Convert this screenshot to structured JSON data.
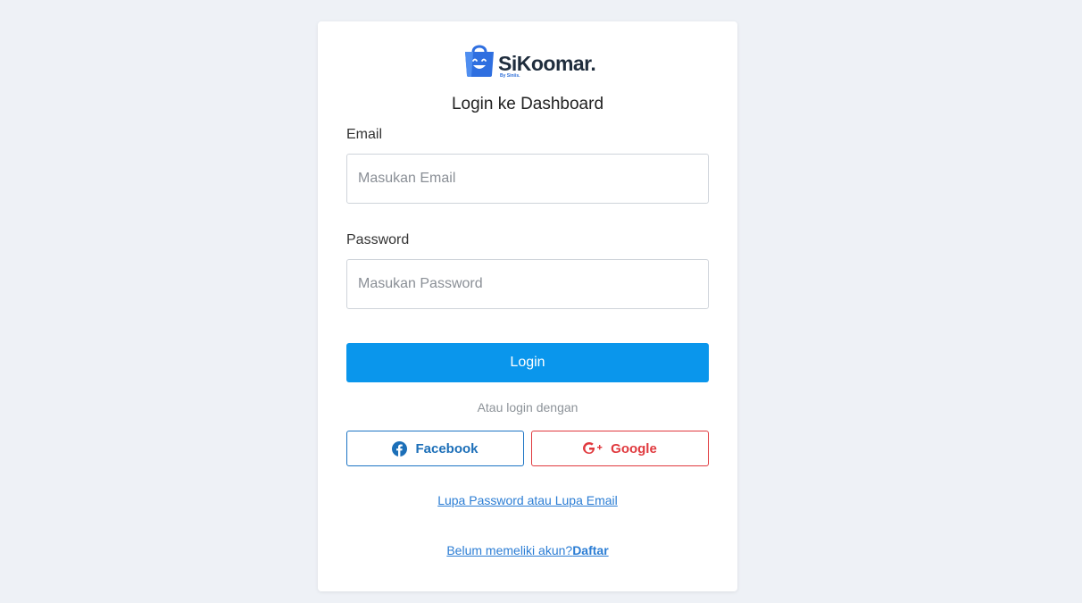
{
  "brand": {
    "name": "SiKoomar.",
    "subtitle": "By Siniis.",
    "logo_icon": "shopping-bag-smiley-icon",
    "logo_color": "#2f6fe0"
  },
  "page": {
    "title": "Login ke Dashboard"
  },
  "form": {
    "email_label": "Email",
    "email_placeholder": "Masukan Email",
    "email_value": "",
    "password_label": "Password",
    "password_placeholder": "Masukan Password",
    "password_value": "",
    "login_label": "Login"
  },
  "social": {
    "divider_text": "Atau login dengan",
    "facebook_label": "Facebook",
    "facebook_icon": "facebook-icon",
    "google_label": "Google",
    "google_icon": "google-plus-icon"
  },
  "links": {
    "forgot": "Lupa Password atau Lupa Email",
    "no_account": "Belum memeliki akun?",
    "register": "Daftar"
  },
  "colors": {
    "background": "#eef1f6",
    "primary": "#0a96ec",
    "facebook": "#1c74c4",
    "google": "#e0393e",
    "link": "#2b7dd4"
  }
}
